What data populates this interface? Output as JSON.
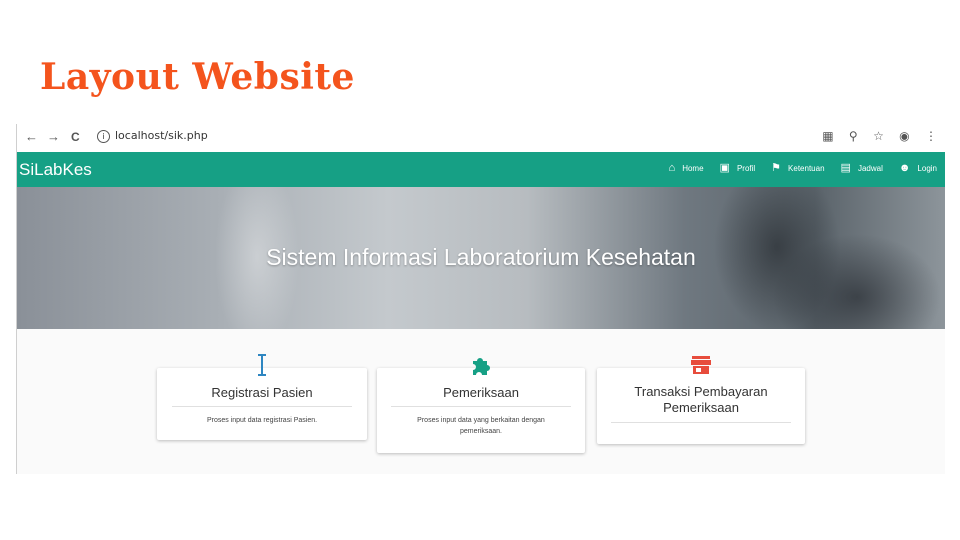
{
  "slide": {
    "title": "Layout Website"
  },
  "browser": {
    "nav": {
      "back": "←",
      "forward": "→",
      "reload": "C"
    },
    "url": "localhost/sik.php",
    "url_host": "localhost",
    "url_path": "/sik.php",
    "toolbar_icons": [
      "translate-icon",
      "zoom-icon",
      "star-icon",
      "account-icon",
      "menu-icon"
    ]
  },
  "app": {
    "brand": "SiLabKes",
    "nav": [
      {
        "label": "Home",
        "icon": "home-icon"
      },
      {
        "label": "Profil",
        "icon": "profile-icon"
      },
      {
        "label": "Ketentuan",
        "icon": "flag-icon"
      },
      {
        "label": "Jadwal",
        "icon": "calendar-icon"
      },
      {
        "label": "Login",
        "icon": "login-icon"
      }
    ],
    "hero_title": "Sistem Informasi Laboratorium Kesehatan",
    "cards": [
      {
        "title": "Registrasi Pasien",
        "desc": "Proses input data registrasi Pasien.",
        "icon": "text-cursor-icon",
        "icon_color": "#2e86c1"
      },
      {
        "title": "Pemeriksaan",
        "desc": "Proses input data yang berkaitan dengan pemeriksaan.",
        "icon": "puzzle-icon",
        "icon_color": "#16a085"
      },
      {
        "title": "Transaksi Pembayaran Pemeriksaan",
        "desc": "",
        "icon": "store-icon",
        "icon_color": "#e74c3c"
      }
    ]
  },
  "colors": {
    "accent": "#16a085",
    "title": "#f4541d"
  }
}
